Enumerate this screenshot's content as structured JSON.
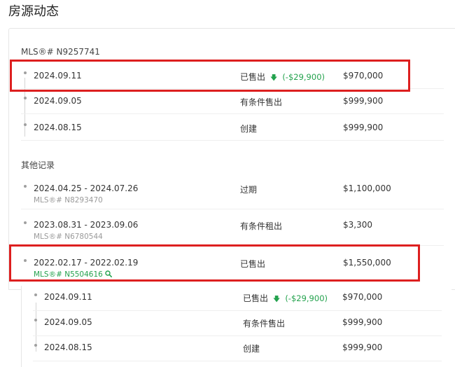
{
  "page_title": "房源动态",
  "current_listing": {
    "mls_label": "MLS®# N9257741",
    "events": [
      {
        "date": "2024.09.11",
        "status": "已售出",
        "change": "(-$29,900)",
        "change_direction": "down",
        "price": "$970,000"
      },
      {
        "date": "2024.09.05",
        "status": "有条件售出",
        "price": "$999,900"
      },
      {
        "date": "2024.08.15",
        "status": "创建",
        "price": "$999,900"
      }
    ]
  },
  "other_records": {
    "label": "其他记录",
    "items": [
      {
        "date": "2024.04.25 - 2024.07.26",
        "mls": "MLS®# N8293470",
        "status": "过期",
        "price": "$1,100,000"
      },
      {
        "date": "2023.08.31 - 2023.09.06",
        "mls": "MLS®# N6780544",
        "status": "有条件租出",
        "price": "$3,300"
      },
      {
        "date": "2022.02.17 - 2022.02.19",
        "mls": "MLS®# N5504616",
        "status": "已售出",
        "price": "$1,550,000"
      }
    ]
  },
  "expanded_record": {
    "events": [
      {
        "date": "2024.09.11",
        "status": "已售出",
        "change": "(-$29,900)",
        "change_direction": "down",
        "price": "$970,000"
      },
      {
        "date": "2024.09.05",
        "status": "有条件售出",
        "price": "$999,900"
      },
      {
        "date": "2024.08.15",
        "status": "创建",
        "price": "$999,900"
      }
    ]
  },
  "colors": {
    "highlight": "#dd1f1f",
    "positive_green": "#23a24d",
    "muted": "#9a9a9a"
  },
  "icons": {
    "down_arrow": "arrow-down-icon",
    "search": "search-icon"
  }
}
